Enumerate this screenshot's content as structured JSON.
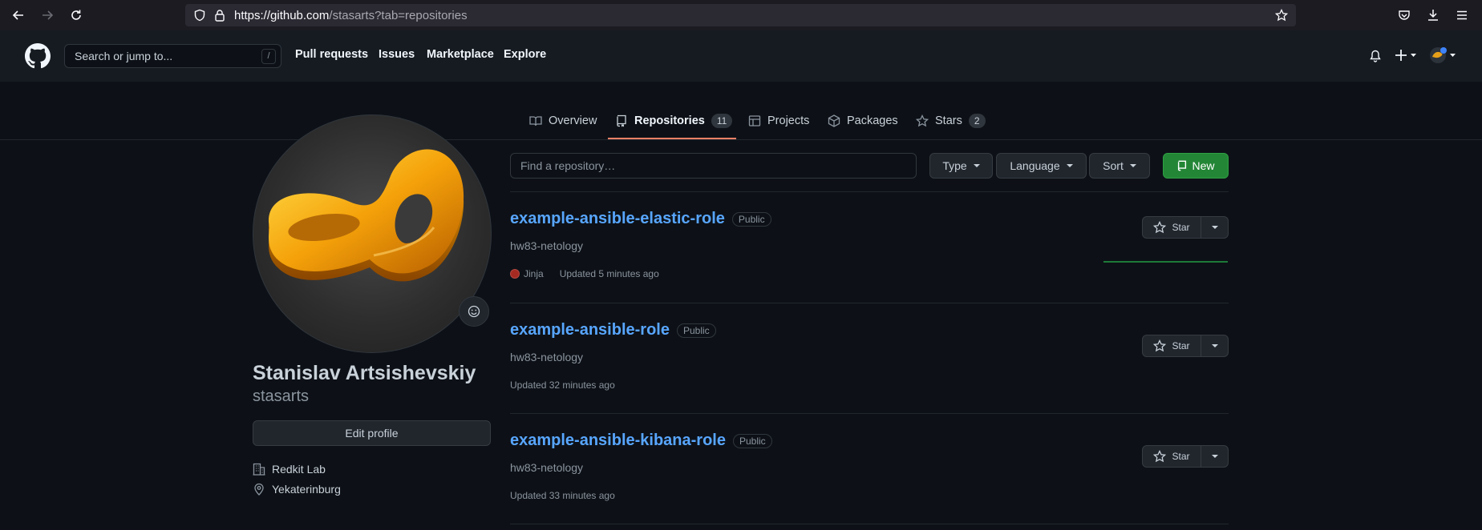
{
  "browser": {
    "url_host": "https://github.com",
    "url_path": "/stasarts?tab=repositories"
  },
  "header": {
    "search_placeholder": "Search or jump to...",
    "search_shortcut": "/",
    "nav": [
      "Pull requests",
      "Issues",
      "Marketplace",
      "Explore"
    ]
  },
  "tabs": [
    {
      "label": "Overview",
      "icon": "book-icon"
    },
    {
      "label": "Repositories",
      "icon": "repo-icon",
      "count": "11",
      "active": true
    },
    {
      "label": "Projects",
      "icon": "table-icon"
    },
    {
      "label": "Packages",
      "icon": "package-icon"
    },
    {
      "label": "Stars",
      "icon": "star-icon",
      "count": "2"
    }
  ],
  "profile": {
    "name": "Stanislav Artsishevskiy",
    "login": "stasarts",
    "edit_label": "Edit profile",
    "organization": "Redkit Lab",
    "location": "Yekaterinburg"
  },
  "filters": {
    "find_placeholder": "Find a repository…",
    "type_label": "Type",
    "language_label": "Language",
    "sort_label": "Sort",
    "new_label": "New"
  },
  "repos": [
    {
      "name": "example-ansible-elastic-role",
      "visibility": "Public",
      "description": "hw83-netology",
      "language": "Jinja",
      "language_color": "#a52a22",
      "updated": "Updated 5 minutes ago",
      "star_label": "Star"
    },
    {
      "name": "example-ansible-role",
      "visibility": "Public",
      "description": "hw83-netology",
      "updated": "Updated 32 minutes ago",
      "star_label": "Star"
    },
    {
      "name": "example-ansible-kibana-role",
      "visibility": "Public",
      "description": "hw83-netology",
      "updated": "Updated 33 minutes ago",
      "star_label": "Star"
    }
  ],
  "colors": {
    "accent_blue": "#58a6ff",
    "primary_green": "#238636",
    "tab_underline": "#f78166",
    "background": "#0d1117"
  }
}
